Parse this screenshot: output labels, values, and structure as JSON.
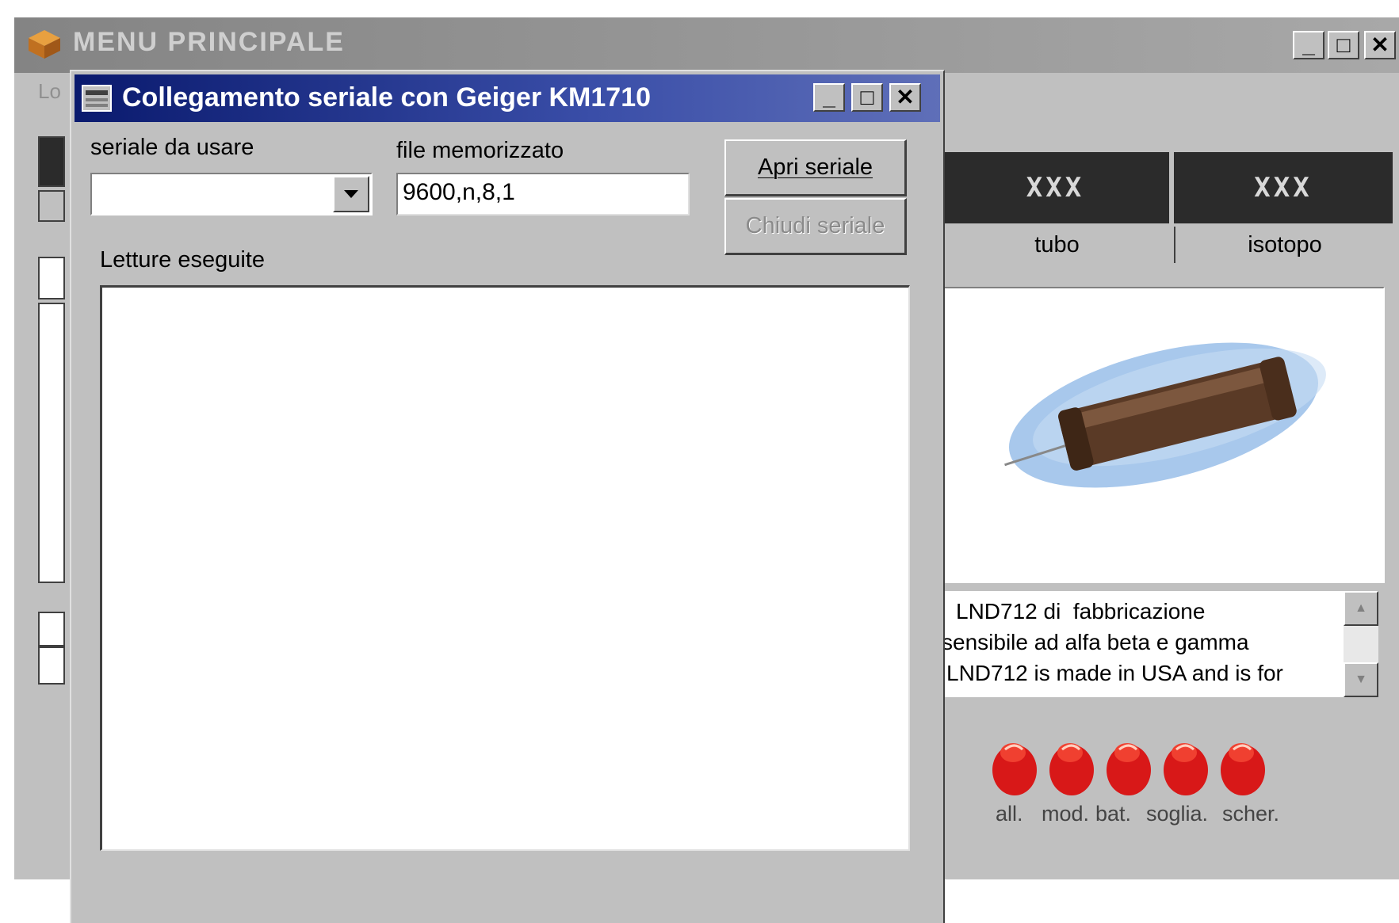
{
  "main_window": {
    "title": "MENU PRINCIPALE",
    "menu_fragment": "Lo",
    "header_cells": [
      "XXX",
      "XXX"
    ],
    "tube_label": "tubo",
    "isotope_label": "isotopo",
    "description_lines": [
      "LND712 di  fabbricazione",
      "sensibile ad alfa beta e gamma",
      "LND712 is made in USA and is for"
    ],
    "leds": [
      {
        "label": "all.",
        "icon": "red-led-icon"
      },
      {
        "label": "mod.",
        "icon": "red-led-icon"
      },
      {
        "label": "bat.",
        "icon": "red-led-icon"
      },
      {
        "label": "soglia.",
        "icon": "red-led-icon"
      },
      {
        "label": "scher.",
        "icon": "red-led-icon"
      }
    ],
    "window_buttons": {
      "minimize": "_",
      "maximize": "□",
      "close": "✕"
    }
  },
  "dialog": {
    "title": "Collegamento seriale con Geiger KM1710",
    "serial_label": "seriale da usare",
    "serial_value": "",
    "stored_label": "file  memorizzato",
    "stored_value": "9600,n,8,1",
    "open_button": "Apri seriale",
    "close_button": "Chiudi seriale",
    "readings_label": "Letture eseguite",
    "window_buttons": {
      "minimize": "_",
      "maximize": "□",
      "close": "✕"
    }
  },
  "colors": {
    "dialog_title_active": "#0a1a6e",
    "main_title_inactive": "#848484",
    "face": "#c0c0c0",
    "led_red": "#e02020"
  }
}
